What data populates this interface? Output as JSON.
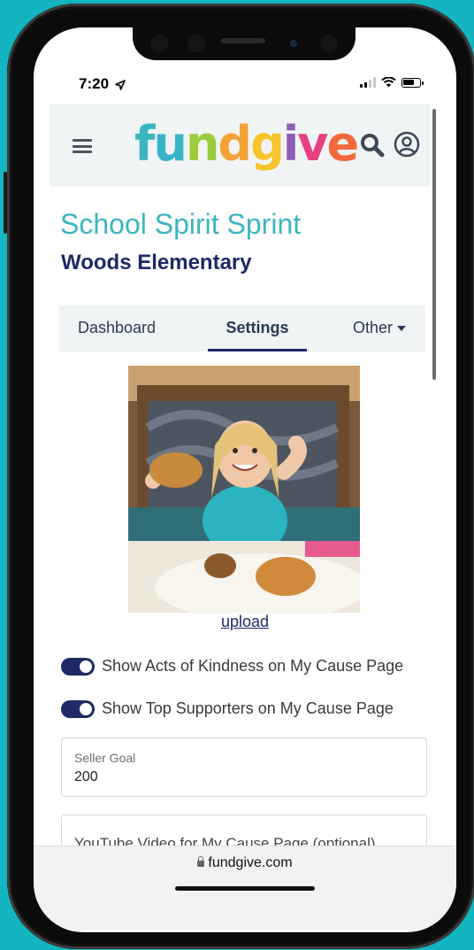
{
  "status_bar": {
    "time": "7:20",
    "signal_bars": 2
  },
  "header": {
    "logo_text": "fundgive"
  },
  "campaign": {
    "title": "School Spirit Sprint",
    "school": "Woods Elementary"
  },
  "tabs": [
    {
      "label": "Dashboard"
    },
    {
      "label": "Settings",
      "active": true
    },
    {
      "label": "Other"
    }
  ],
  "photo": {
    "upload_label": "upload"
  },
  "toggles": [
    {
      "label": "Show Acts of Kindness on My Cause Page",
      "on": true
    },
    {
      "label": "Show Top Supporters on My Cause Page",
      "on": true
    }
  ],
  "fields": {
    "seller_goal": {
      "label": "Seller Goal",
      "value": "200"
    },
    "youtube": {
      "label": "YouTube Video for My Cause Page (optional)"
    }
  },
  "browser": {
    "url": "fundgive.com"
  },
  "colors": {
    "brand_teal": "#3db5c1",
    "brand_navy": "#1d2a66",
    "background": "#13b6c0"
  }
}
